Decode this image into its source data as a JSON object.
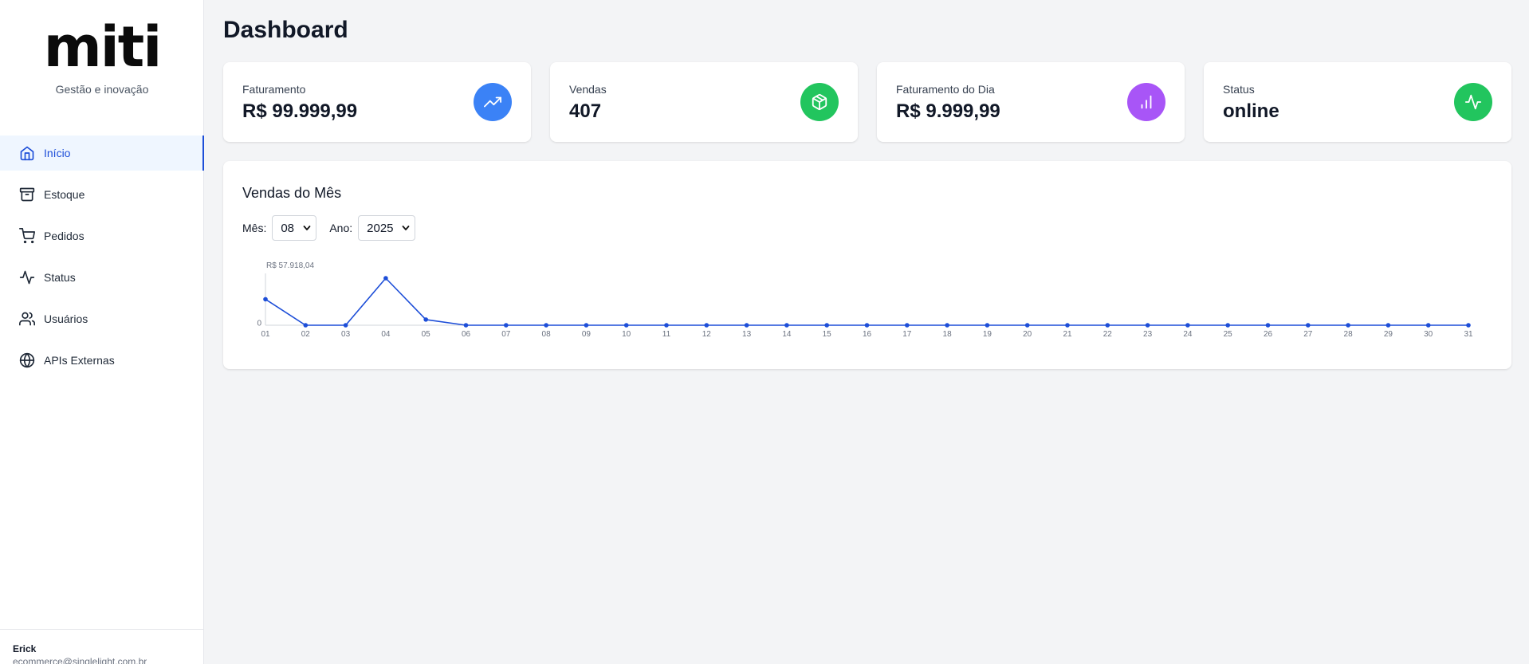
{
  "sidebar": {
    "logo": "miti",
    "tagline": "Gestão e inovação",
    "items": [
      {
        "label": "Início",
        "icon": "home-icon",
        "active": true
      },
      {
        "label": "Estoque",
        "icon": "archive-icon"
      },
      {
        "label": "Pedidos",
        "icon": "cart-icon"
      },
      {
        "label": "Status",
        "icon": "activity-icon"
      },
      {
        "label": "Usuários",
        "icon": "users-icon"
      },
      {
        "label": "APIs Externas",
        "icon": "globe-icon"
      }
    ],
    "user": {
      "name": "Erick",
      "email": "ecommerce@singlelight.com.br"
    }
  },
  "page": {
    "title": "Dashboard"
  },
  "cards": [
    {
      "label": "Faturamento",
      "value": "R$ 99.999,99",
      "icon": "trending-up-icon",
      "color": "#3b82f6"
    },
    {
      "label": "Vendas",
      "value": "407",
      "icon": "package-icon",
      "color": "#22c55e"
    },
    {
      "label": "Faturamento do Dia",
      "value": "R$ 9.999,99",
      "icon": "bar-chart-icon",
      "color": "#a855f7"
    },
    {
      "label": "Status",
      "value": "online",
      "icon": "activity-icon",
      "color": "#22c55e"
    }
  ],
  "sales_panel": {
    "title": "Vendas do Mês",
    "month_label": "Mês:",
    "month_value": "08",
    "year_label": "Ano:",
    "year_value": "2025"
  },
  "chart_data": {
    "type": "line",
    "x": [
      "01",
      "02",
      "03",
      "04",
      "05",
      "06",
      "07",
      "08",
      "09",
      "10",
      "11",
      "12",
      "13",
      "14",
      "15",
      "16",
      "17",
      "18",
      "19",
      "20",
      "21",
      "22",
      "23",
      "24",
      "25",
      "26",
      "27",
      "28",
      "29",
      "30",
      "31"
    ],
    "values": [
      32000,
      0,
      0,
      57918.04,
      7000,
      0,
      0,
      0,
      0,
      0,
      0,
      0,
      0,
      0,
      0,
      0,
      0,
      0,
      0,
      0,
      0,
      0,
      0,
      0,
      0,
      0,
      0,
      0,
      0,
      0,
      0
    ],
    "y_tick_labels": [
      "0",
      "R$ 57.918,04"
    ],
    "ylim": [
      0,
      57918.04
    ],
    "color": "#1d4ed8",
    "grid": false
  }
}
